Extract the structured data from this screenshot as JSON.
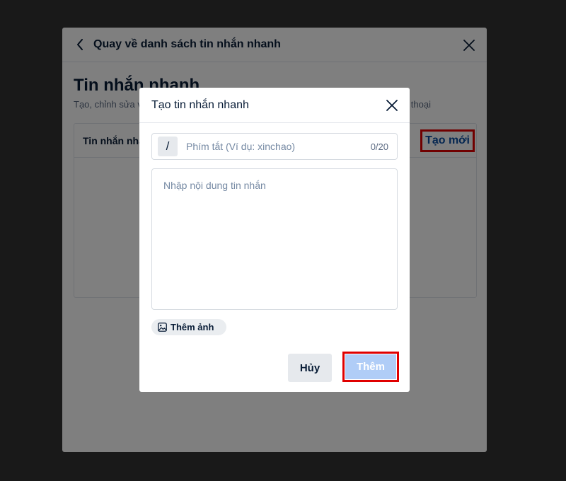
{
  "background_panel": {
    "header_title": "Quay về danh sách tin nhắn nhanh",
    "title": "Tin nhắn nhanh",
    "subtitle_left": "Tạo, chỉnh sửa v",
    "subtitle_right": "thoại",
    "list_header_label": "Tin nhắn nha",
    "create_new_label": "Tạo mới"
  },
  "modal": {
    "title": "Tạo tin nhắn nhanh",
    "shortcut_prefix": "/",
    "shortcut_placeholder": "Phím tắt (Ví dụ: xinchao)",
    "shortcut_count": "0/20",
    "content_placeholder": "Nhập nội dung tin nhắn",
    "add_image_label": "Thêm ảnh",
    "cancel_label": "Hủy",
    "add_label": "Thêm"
  },
  "colors": {
    "highlight_border": "#e00000",
    "primary_disabled": "#b0cdf7",
    "link_blue": "#0b4ea2"
  }
}
